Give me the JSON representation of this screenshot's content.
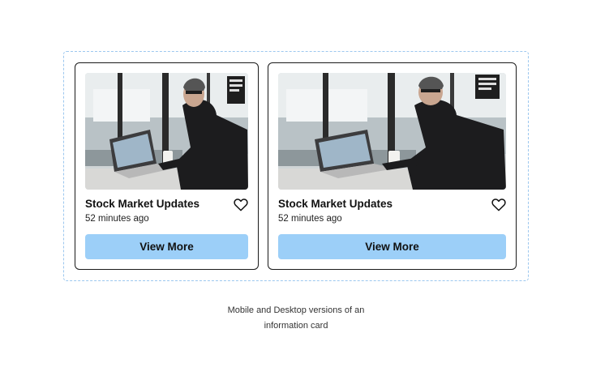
{
  "cards": [
    {
      "variant": "mobile",
      "image_icon": "photo-man-at-laptop",
      "title": "Stock Market Updates",
      "time": "52 minutes ago",
      "favorite_icon": "heart-outline-icon",
      "button_label": "View More"
    },
    {
      "variant": "desktop",
      "image_icon": "photo-man-at-laptop",
      "title": "Stock Market Updates",
      "time": "52 minutes ago",
      "favorite_icon": "heart-outline-icon",
      "button_label": "View More"
    }
  ],
  "caption": {
    "line1": "Mobile and Desktop versions of an",
    "line2": "information card"
  },
  "colors": {
    "button_bg": "#9ccff8",
    "frame_border": "#9cc7ef",
    "card_border": "#1a1a1a"
  }
}
